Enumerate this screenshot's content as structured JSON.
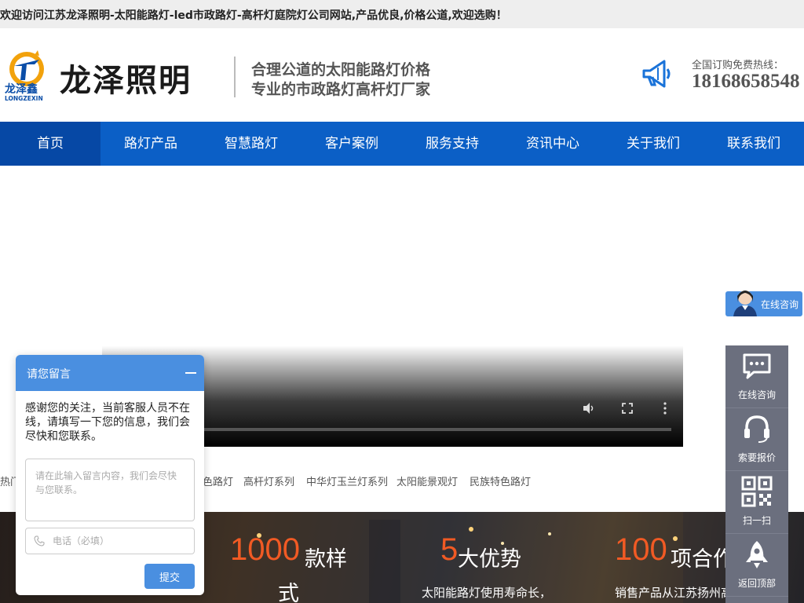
{
  "topbar": {
    "welcome": "欢迎访问江苏龙泽照明-太阳能路灯-led市政路灯-高杆灯庭院灯公司网站,产品优良,价格公道,欢迎选购！"
  },
  "header": {
    "logo_text": "龙泽照明",
    "logo_mark_cn": "龙泽鑫",
    "logo_mark_en": "LONGZEXIN",
    "slogan_line1": "合理公道的太阳能路灯价格",
    "slogan_line2": "专业的市政路灯高杆灯厂家",
    "hotline_label": "全国订购免费热线：",
    "hotline_number": "18168658548"
  },
  "nav": {
    "items": [
      {
        "label": "首页"
      },
      {
        "label": "路灯产品"
      },
      {
        "label": "智慧路灯"
      },
      {
        "label": "客户案例"
      },
      {
        "label": "服务支持"
      },
      {
        "label": "资讯中心"
      },
      {
        "label": "关于我们"
      },
      {
        "label": "联系我们"
      }
    ]
  },
  "hot": {
    "label": "热门",
    "items": [
      "色路灯",
      "高杆灯系列",
      "中华灯玉兰灯系列",
      "太阳能景观灯",
      "民族特色路灯"
    ]
  },
  "stats": [
    {
      "num": "1000",
      "word": "款样",
      "word2": "式",
      "desc": ""
    },
    {
      "num": "5",
      "word": "大优势",
      "desc": "太阳能路灯使用寿命长，"
    },
    {
      "num": "100",
      "word": "项合作",
      "desc": "销售产品从江苏扬州高"
    }
  ],
  "online": {
    "label": "在线咨询"
  },
  "side": {
    "items": [
      {
        "label": "在线咨询",
        "icon": "chat-icon"
      },
      {
        "label": "索要报价",
        "icon": "headset-icon"
      },
      {
        "label": "扫一扫",
        "icon": "qrcode-icon"
      },
      {
        "label": "返回顶部",
        "icon": "rocket-icon"
      }
    ]
  },
  "message": {
    "title": "请您留言",
    "intro": "感谢您的关注，当前客服人员不在线，请填写一下您的信息，我们会尽快和您联系。",
    "textarea_placeholder": "请在此输入留言内容，我们会尽快与您联系。",
    "phone_placeholder": "电话（必填）",
    "submit": "提交"
  },
  "colors": {
    "nav_bg": "#0b5fc6",
    "nav_active": "#0648a5",
    "accent": "#f15a24",
    "widget_blue": "#4a8fe0",
    "side_bg": "#6b6f7e"
  }
}
